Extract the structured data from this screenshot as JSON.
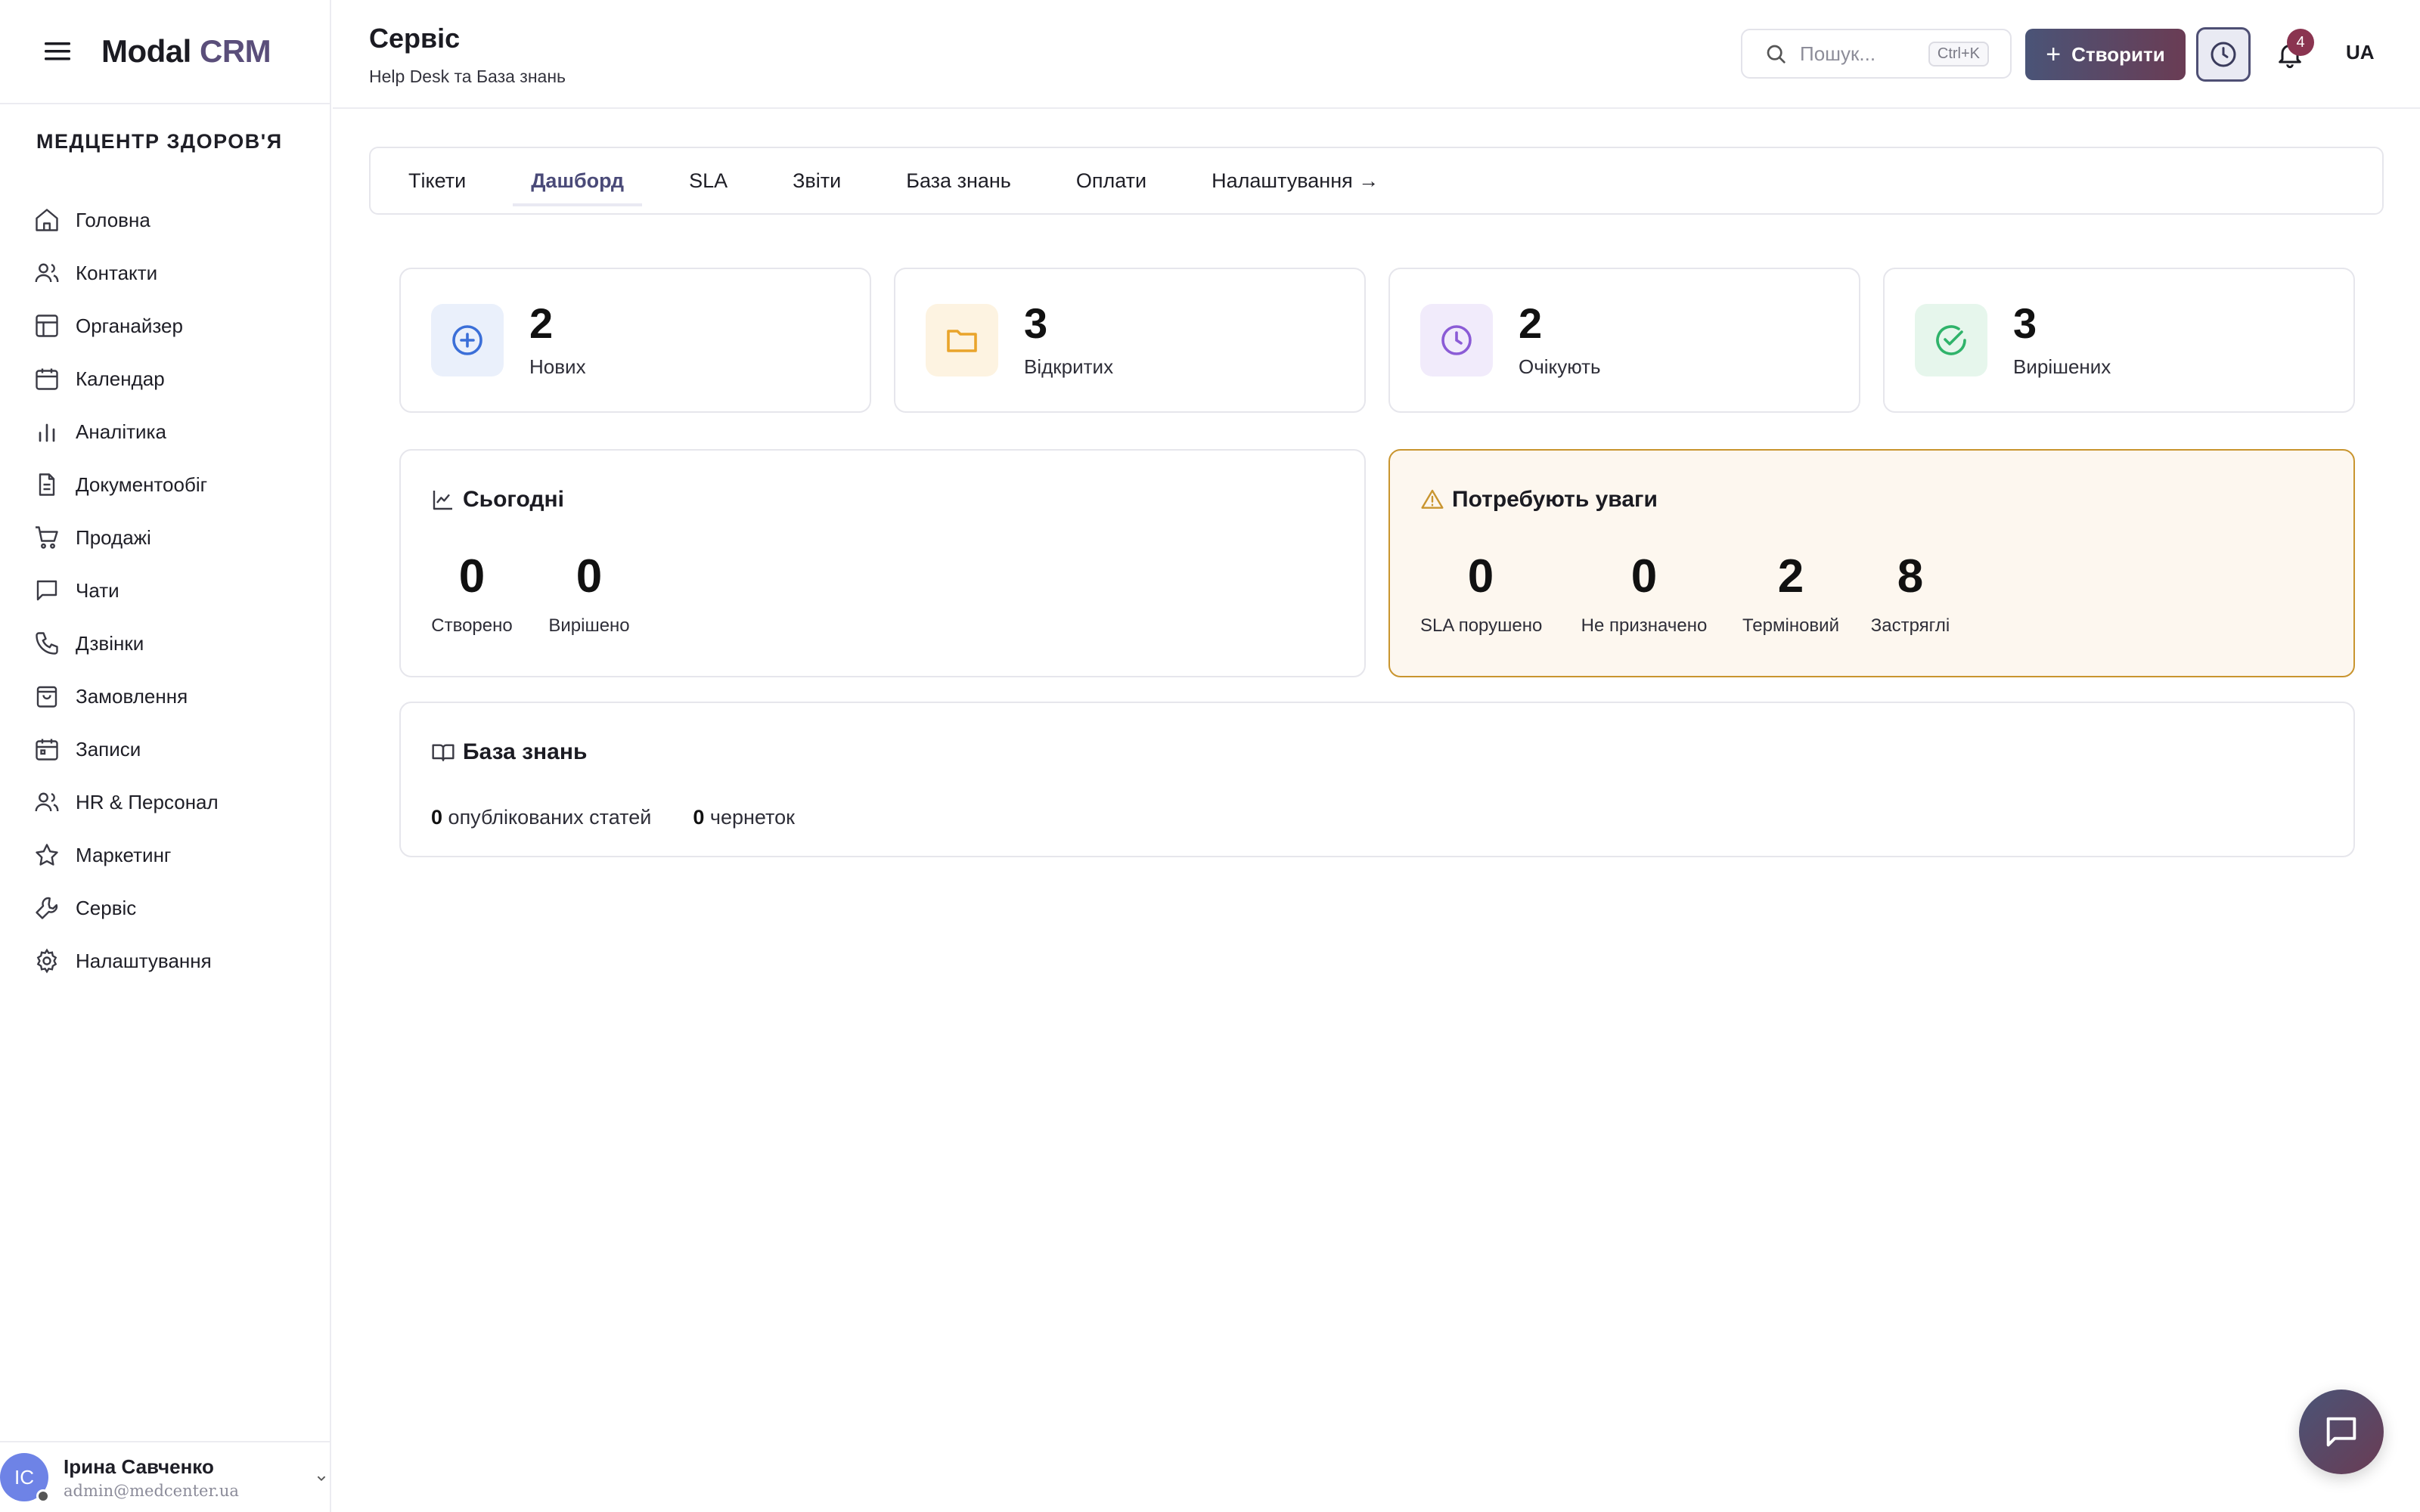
{
  "brand": {
    "part1": "Modal",
    "part2": "CRM"
  },
  "organization": "МЕДЦЕНТР ЗДОРОВ'Я",
  "sidebar": {
    "items": [
      {
        "label": "Головна",
        "icon": "home-icon"
      },
      {
        "label": "Контакти",
        "icon": "users-icon"
      },
      {
        "label": "Органайзер",
        "icon": "layout-icon"
      },
      {
        "label": "Календар",
        "icon": "calendar-icon"
      },
      {
        "label": "Аналітика",
        "icon": "bar-chart-icon"
      },
      {
        "label": "Документообіг",
        "icon": "file-icon"
      },
      {
        "label": "Продажі",
        "icon": "cart-icon"
      },
      {
        "label": "Чати",
        "icon": "message-icon"
      },
      {
        "label": "Дзвінки",
        "icon": "phone-icon"
      },
      {
        "label": "Замовлення",
        "icon": "bag-icon"
      },
      {
        "label": "Записи",
        "icon": "calendar-check-icon"
      },
      {
        "label": "HR & Персонал",
        "icon": "users-icon"
      },
      {
        "label": "Маркетинг",
        "icon": "star-icon"
      },
      {
        "label": "Сервіс",
        "icon": "wrench-icon"
      },
      {
        "label": "Налаштування",
        "icon": "gear-icon"
      }
    ]
  },
  "user": {
    "initials": "IC",
    "name": "Ірина Савченко",
    "email": "admin@medcenter.ua"
  },
  "header": {
    "title": "Сервіс",
    "subtitle": "Help Desk та База знань",
    "search_placeholder": "Пошук...",
    "search_shortcut": "Ctrl+K",
    "create_label": "Створити",
    "notifications_count": "4",
    "language": "UA"
  },
  "tabs": [
    {
      "label": "Тікети"
    },
    {
      "label": "Дашборд",
      "active": true
    },
    {
      "label": "SLA"
    },
    {
      "label": "Звіти"
    },
    {
      "label": "База знань"
    },
    {
      "label": "Оплати"
    },
    {
      "label": "Налаштування →"
    }
  ],
  "stats": [
    {
      "value": "2",
      "label": "Нових",
      "icon": "plus-circle-icon",
      "color": "#3b6fd8",
      "bg": "#eaf0fb"
    },
    {
      "value": "3",
      "label": "Відкритих",
      "icon": "folder-icon",
      "color": "#e9a42b",
      "bg": "#fdf3e1"
    },
    {
      "value": "2",
      "label": "Очікують",
      "icon": "clock-icon",
      "color": "#8b5bd6",
      "bg": "#f1ebfb"
    },
    {
      "value": "3",
      "label": "Вирішених",
      "icon": "check-circle-icon",
      "color": "#2fb36a",
      "bg": "#e6f6ec"
    }
  ],
  "today": {
    "title": "Сьогодні",
    "metrics": [
      {
        "value": "0",
        "label": "Створено"
      },
      {
        "value": "0",
        "label": "Вирішено"
      }
    ]
  },
  "attention": {
    "title": "Потребують уваги",
    "metrics": [
      {
        "value": "0",
        "label": "SLA порушено"
      },
      {
        "value": "0",
        "label": "Не призначено"
      },
      {
        "value": "2",
        "label": "Терміновий"
      },
      {
        "value": "8",
        "label": "Застряглі"
      }
    ],
    "accent": "#c9952f",
    "bg": "#fdf7ef"
  },
  "knowledge": {
    "title": "База знань",
    "published_count": "0",
    "published_label": "опублікованих статей",
    "drafts_count": "0",
    "drafts_label": "чернеток"
  }
}
